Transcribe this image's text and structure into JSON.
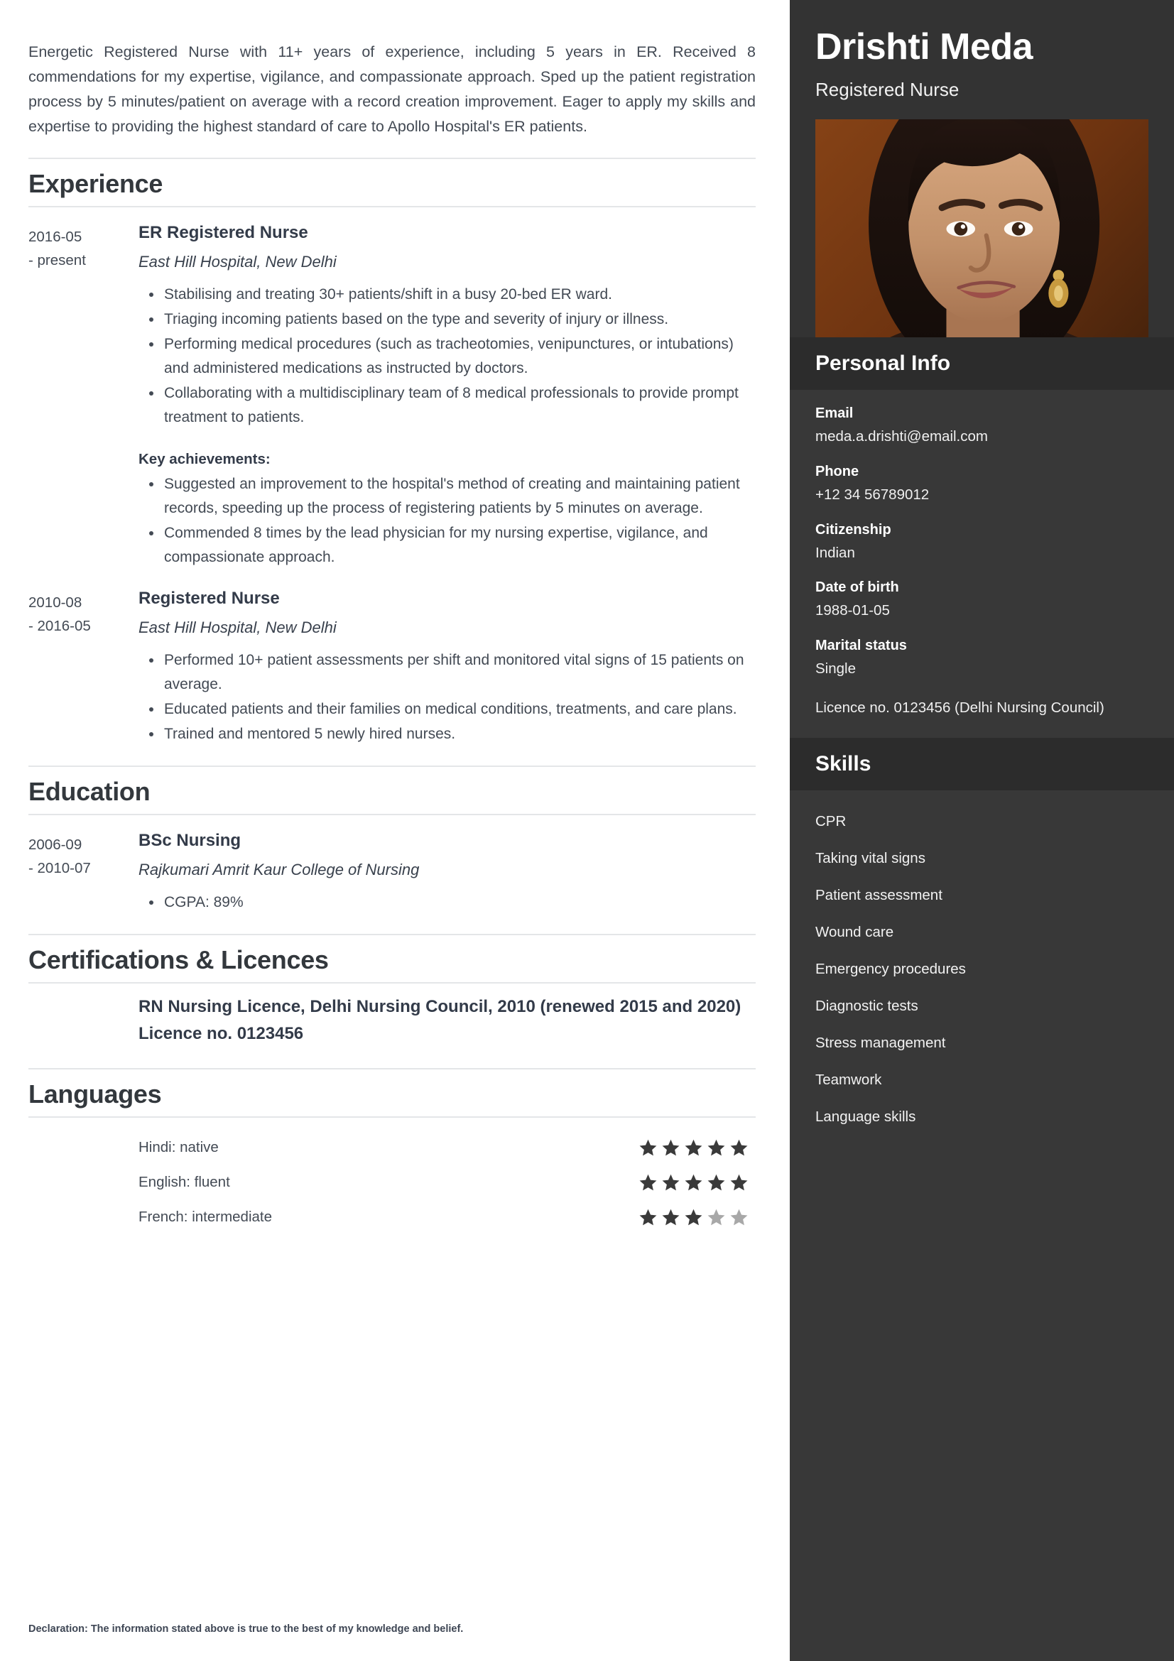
{
  "summary": "Energetic Registered Nurse with 11+ years of experience, including 5 years in ER. Received 8 commendations for my expertise, vigilance, and compassionate approach. Sped up the patient registration process by 5 minutes/patient on average with a record creation improvement. Eager to apply my skills and expertise to providing the highest standard of care to Apollo Hospital's ER patients.",
  "sections": {
    "experience_title": "Experience",
    "education_title": "Education",
    "certifications_title": "Certifications & Licences",
    "languages_title": "Languages"
  },
  "experience": [
    {
      "date_start": "2016-05",
      "date_end": "- present",
      "title": "ER Registered Nurse",
      "employer": "East Hill Hospital, New Delhi",
      "bullets": [
        "Stabilising and treating 30+ patients/shift in a busy 20-bed ER ward.",
        "Triaging incoming patients based on the type and severity of injury or illness.",
        "Performing medical procedures (such as tracheotomies, venipunctures, or intubations) and administered medications as instructed by doctors.",
        "Collaborating with a multidisciplinary team of 8 medical professionals to provide prompt treatment to patients."
      ],
      "achievements_label": "Key achievements:",
      "achievements": [
        "Suggested an improvement to the hospital's method of creating and maintaining patient records, speeding up the process of registering patients by 5 minutes on average.",
        "Commended 8 times by the lead physician for my nursing expertise, vigilance, and compassionate approach."
      ]
    },
    {
      "date_start": "2010-08",
      "date_end": "- 2016-05",
      "title": "Registered Nurse",
      "employer": "East Hill Hospital, New Delhi",
      "bullets": [
        "Performed 10+ patient assessments per shift and monitored vital signs of 15 patients on average.",
        "Educated patients and their families on medical conditions, treatments, and care plans.",
        "Trained and mentored 5 newly hired nurses."
      ],
      "achievements_label": "",
      "achievements": []
    }
  ],
  "education": [
    {
      "date_start": "2006-09",
      "date_end": "- 2010-07",
      "title": "BSc Nursing",
      "school": "Rajkumari Amrit Kaur College of Nursing",
      "bullets": [
        "CGPA: 89%"
      ]
    }
  ],
  "certifications": {
    "text": "RN Nursing Licence, Delhi Nursing Council, 2010 (renewed 2015 and 2020) Licence no. 0123456"
  },
  "languages": [
    {
      "label": "Hindi: native",
      "rating": 5,
      "max": 5
    },
    {
      "label": "English: fluent",
      "rating": 5,
      "max": 5
    },
    {
      "label": "French: intermediate",
      "rating": 3,
      "max": 5
    }
  ],
  "declaration": "Declaration: The information stated above is true to the best of my knowledge and belief.",
  "sidebar": {
    "name": "Drishti Meda",
    "role": "Registered Nurse",
    "personal_info_title": "Personal Info",
    "personal_info": [
      {
        "label": "Email",
        "value": "meda.a.drishti@email.com"
      },
      {
        "label": "Phone",
        "value": "+12 34 56789012"
      },
      {
        "label": "Citizenship",
        "value": "Indian"
      },
      {
        "label": "Date of birth",
        "value": "1988-01-05"
      },
      {
        "label": "Marital status",
        "value": "Single"
      }
    ],
    "licence_note": "Licence no. 0123456 (Delhi Nursing Council)",
    "skills_title": "Skills",
    "skills": [
      "CPR",
      "Taking vital signs",
      "Patient assessment",
      "Wound care",
      "Emergency procedures",
      "Diagnostic tests",
      "Stress management",
      "Teamwork",
      "Language skills"
    ]
  },
  "colors": {
    "sidebar_bg": "#383838",
    "sidebar_header_bg": "#333333",
    "sidebar_bar_bg": "#2c2c2c",
    "text": "#434a54",
    "heading": "#33383d",
    "star_filled": "#3a3a3a",
    "star_empty": "#a8a8a8",
    "rule": "#e4e6e8"
  }
}
